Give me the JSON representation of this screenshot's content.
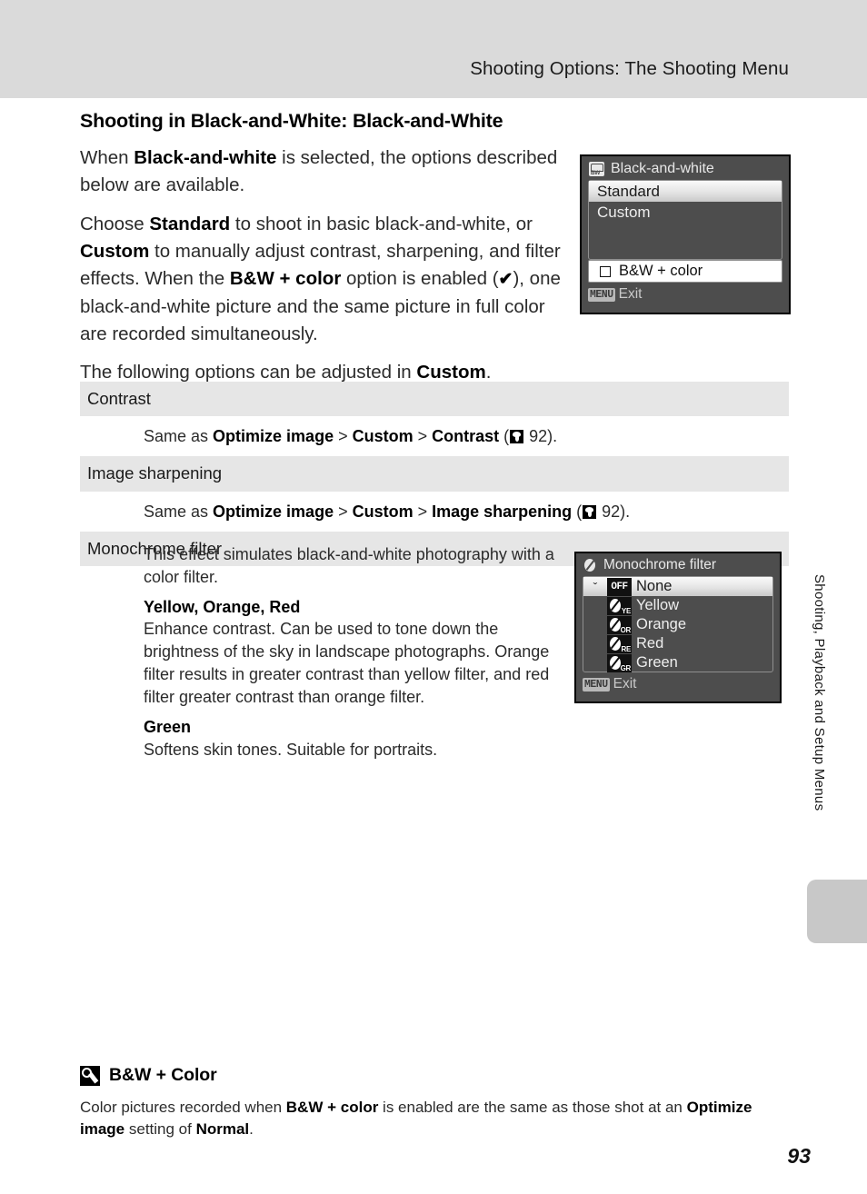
{
  "header": {
    "running_title": "Shooting Options: The Shooting Menu"
  },
  "section": {
    "title": "Shooting in Black-and-White: Black-and-White",
    "para1_a": "When ",
    "para1_b": "Black-and-white",
    "para1_c": " is selected, the options described below are available.",
    "para2_a": "Choose ",
    "para2_b": "Standard",
    "para2_c": " to shoot in basic black-and-white, or ",
    "para2_d": "Custom",
    "para2_e": " to manually adjust contrast, sharpening, and filter effects. When the ",
    "para2_f": "B&W + color",
    "para2_g": " option is enabled (",
    "check_glyph": "✔",
    "para2_h": "), one black-and-white picture and the same picture in full color are recorded simultaneously.",
    "para3_a": "The following options can be adjusted in ",
    "para3_b": "Custom",
    "para3_c": "."
  },
  "lcd_black_and_white": {
    "header_icon": "black-and-white-mode-icon",
    "title": "Black-and-white",
    "options": [
      {
        "label": "Standard",
        "selected": true
      },
      {
        "label": "Custom",
        "selected": false
      }
    ],
    "checkbox_row": {
      "label": "B&W + color",
      "checked": false
    },
    "footer_key": "MENU",
    "footer_label": "Exit"
  },
  "lcd_monochrome_filter": {
    "header_icon": "monochrome-filter-icon",
    "title": "Monochrome filter",
    "options": [
      {
        "badge": "OFF",
        "code": "",
        "label": "None",
        "selected": true,
        "check": "ˇ"
      },
      {
        "badge": "",
        "code": "YE",
        "label": "Yellow",
        "selected": false,
        "check": ""
      },
      {
        "badge": "",
        "code": "OR",
        "label": "Orange",
        "selected": false,
        "check": ""
      },
      {
        "badge": "",
        "code": "RE",
        "label": "Red",
        "selected": false,
        "check": ""
      },
      {
        "badge": "",
        "code": "GR",
        "label": "Green",
        "selected": false,
        "check": ""
      }
    ],
    "footer_key": "MENU",
    "footer_label": "Exit"
  },
  "option_table": [
    {
      "heading": "Contrast",
      "body_a": "Same as ",
      "body_b": "Optimize image",
      "body_c": " > ",
      "body_d": "Custom",
      "body_e": " > ",
      "body_f": "Contrast",
      "body_g": " (",
      "ref_icon": "page-reference-icon",
      "page": " 92).",
      "suffix": ""
    },
    {
      "heading": "Image sharpening",
      "body_a": "Same as ",
      "body_b": "Optimize image",
      "body_c": " > ",
      "body_d": "Custom",
      "body_e": " > ",
      "body_f": "Image sharpening",
      "body_g": " (",
      "ref_icon": "page-reference-icon",
      "page": " 92).",
      "suffix": ""
    },
    {
      "heading": "Monochrome filter"
    }
  ],
  "mono_desc": {
    "intro": "This effect simulates black-and-white photography with a color filter.",
    "subhead1": "Yellow, Orange, Red",
    "text1": "Enhance contrast. Can be used to tone down the brightness of the sky in landscape photographs. Orange filter results in greater contrast than yellow filter, and red filter greater contrast than orange filter.",
    "subhead2": "Green",
    "text2": "Softens skin tones. Suitable for portraits."
  },
  "side_tab": {
    "text": "Shooting, Playback and Setup Menus"
  },
  "note": {
    "icon": "note-pencil-icon",
    "title": "B&W + Color",
    "body_a": "Color pictures recorded when ",
    "body_b": "B&W + color",
    "body_c": " is enabled are the same as those shot at an ",
    "body_d": "Optimize image",
    "body_e": " setting of ",
    "body_f": "Normal",
    "body_g": "."
  },
  "page_number": "93",
  "colors": {
    "header_band": "#dadada",
    "table_heading_bg": "#e6e6e6",
    "lcd_body": "#4d4d4d",
    "side_tab": "#c8c8c8"
  }
}
